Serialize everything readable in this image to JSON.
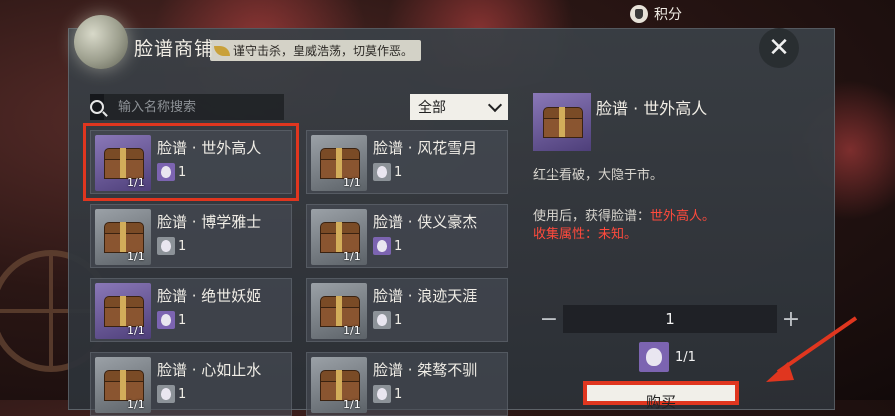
{
  "top_bar": {
    "points_label": "积分"
  },
  "header": {
    "title": "脸谱商铺",
    "motto": "谨守击杀，皇威浩荡，切莫作恶。"
  },
  "search": {
    "placeholder": "输入名称搜索"
  },
  "filter": {
    "selected": "全部"
  },
  "items": [
    {
      "name": "脸谱 · 世外高人",
      "qty": "1/1",
      "cost": "1",
      "tier": "purple",
      "selected": true
    },
    {
      "name": "脸谱 · 风花雪月",
      "qty": "1/1",
      "cost": "1",
      "tier": "gray",
      "selected": false
    },
    {
      "name": "脸谱 · 博学雅士",
      "qty": "1/1",
      "cost": "1",
      "tier": "gray",
      "selected": false
    },
    {
      "name": "脸谱 · 侠义豪杰",
      "qty": "1/1",
      "cost": "1",
      "tier": "gray",
      "selected": false
    },
    {
      "name": "脸谱 · 绝世妖姬",
      "qty": "1/1",
      "cost": "1",
      "tier": "purple",
      "selected": false
    },
    {
      "name": "脸谱 · 浪迹天涯",
      "qty": "1/1",
      "cost": "1",
      "tier": "gray",
      "selected": false
    },
    {
      "name": "脸谱 · 心如止水",
      "qty": "1/1",
      "cost": "1",
      "tier": "gray",
      "selected": false
    },
    {
      "name": "脸谱 · 桀骜不驯",
      "qty": "1/1",
      "cost": "1",
      "tier": "gray",
      "selected": false
    }
  ],
  "detail": {
    "name": "脸谱 · 世外高人",
    "description": "红尘看破，大隐于市。",
    "use_prefix": "使用后，获得脸谱：",
    "use_value": "世外高人。",
    "attr_label": "收集属性：未知。",
    "quantity": "1",
    "minus": "−",
    "plus": "+",
    "cost_ratio": "1/1",
    "confirm_label": "购买"
  },
  "colors": {
    "highlight": "#e0361f",
    "purple_tier": "#7c64b1",
    "gray_tier": "#8c9298",
    "red_text": "#ff4a3c"
  }
}
